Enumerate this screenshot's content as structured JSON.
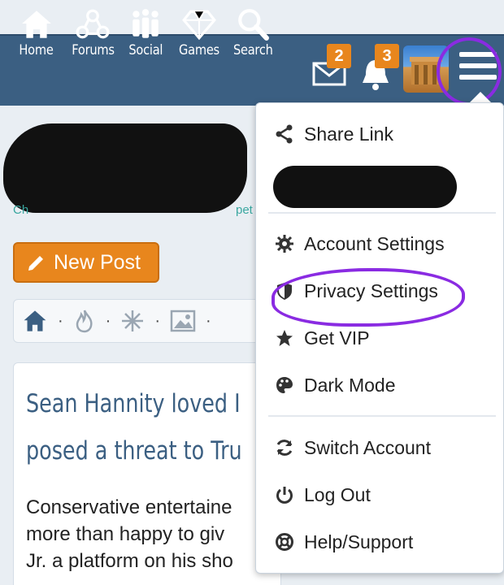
{
  "nav": {
    "items": [
      {
        "label": "Home",
        "icon": "home-icon"
      },
      {
        "label": "Forums",
        "icon": "forums-icon"
      },
      {
        "label": "Social",
        "icon": "social-icon"
      },
      {
        "label": "Games",
        "icon": "diamond-icon"
      },
      {
        "label": "Search",
        "icon": "search-icon"
      }
    ],
    "messages_badge": "2",
    "notifications_badge": "3"
  },
  "page": {
    "partial_text": "Ch",
    "partial_text_2": "pet",
    "new_post_label": "New Post",
    "article_title_line1": "Sean Hannity loved I",
    "article_title_line2": "posed a threat to Tru",
    "article_body_line1": "Conservative entertaine",
    "article_body_line2": "more than happy to giv",
    "article_body_line3": "Jr. a platform on his sho"
  },
  "menu": {
    "share_link": "Share Link",
    "account_settings": "Account Settings",
    "privacy_settings": "Privacy Settings",
    "get_vip": "Get VIP",
    "dark_mode": "Dark Mode",
    "switch_account": "Switch Account",
    "log_out": "Log Out",
    "help_support": "Help/Support"
  },
  "colors": {
    "navbar": "#3b5f82",
    "accent_orange": "#e8861d",
    "annotation_purple": "#8a2be2"
  }
}
